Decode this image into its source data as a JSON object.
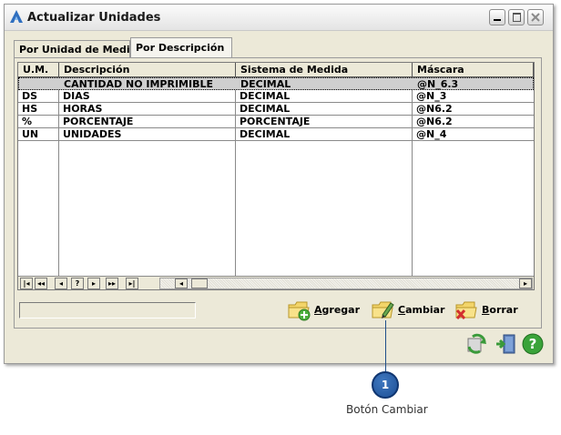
{
  "window": {
    "title": "Actualizar Unidades"
  },
  "tabs": [
    {
      "label": "Por Unidad de Medida",
      "active": false
    },
    {
      "label": "Por Descripción",
      "active": true
    }
  ],
  "grid": {
    "columns": [
      "U.M.",
      "Descripción",
      "Sistema de Medida",
      "Máscara"
    ],
    "rows": [
      {
        "um": "",
        "descripcion": "CANTIDAD NO IMPRIMIBLE",
        "sistema": "DECIMAL",
        "mascara": "@N_6.3",
        "selected": true
      },
      {
        "um": "DS",
        "descripcion": "DIAS",
        "sistema": "DECIMAL",
        "mascara": "@N_3"
      },
      {
        "um": "HS",
        "descripcion": "HORAS",
        "sistema": "DECIMAL",
        "mascara": "@N6.2"
      },
      {
        "um": "%",
        "descripcion": "PORCENTAJE",
        "sistema": "PORCENTAJE",
        "mascara": "@N6.2"
      },
      {
        "um": "UN",
        "descripcion": "UNIDADES",
        "sistema": "DECIMAL",
        "mascara": "@N_4"
      }
    ],
    "nav_buttons": [
      "|◂",
      "◂◂",
      "◂",
      "?",
      "▸",
      "▸▸",
      "▸|"
    ]
  },
  "actions": {
    "agregar": {
      "key": "A",
      "rest": "gregar"
    },
    "cambiar": {
      "key": "C",
      "rest": "ambiar"
    },
    "borrar": {
      "key": "B",
      "rest": "orrar"
    }
  },
  "footer_icons": [
    "refresh-icon",
    "exit-door-icon",
    "help-icon"
  ],
  "callout": {
    "number": "1",
    "label": "Botón Cambiar"
  },
  "colors": {
    "selected_row": "#cfcfcf",
    "callout": "#1d4f95",
    "window_bg": "#ece9d8"
  }
}
